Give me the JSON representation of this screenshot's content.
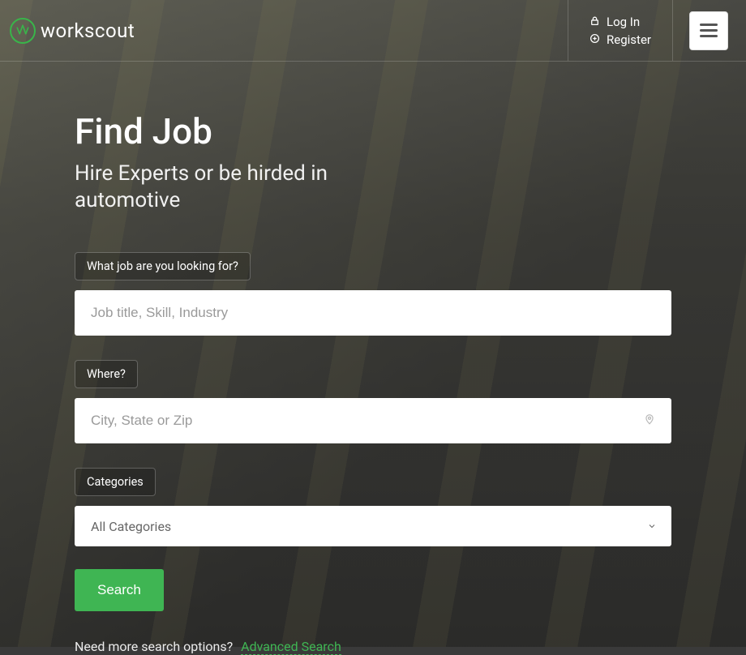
{
  "brand": {
    "name": "workscout"
  },
  "header": {
    "login_label": "Log In",
    "register_label": "Register"
  },
  "hero": {
    "title": "Find Job",
    "subtitle": "Hire Experts or be hirded in automotive"
  },
  "search": {
    "job_label": "What job are you looking for?",
    "job_placeholder": "Job title, Skill, Industry",
    "where_label": "Where?",
    "where_placeholder": "City, State or Zip",
    "categories_label": "Categories",
    "categories_selected": "All Categories",
    "button_label": "Search"
  },
  "footer": {
    "more_text": "Need more search options?",
    "advanced_label": "Advanced Search"
  }
}
